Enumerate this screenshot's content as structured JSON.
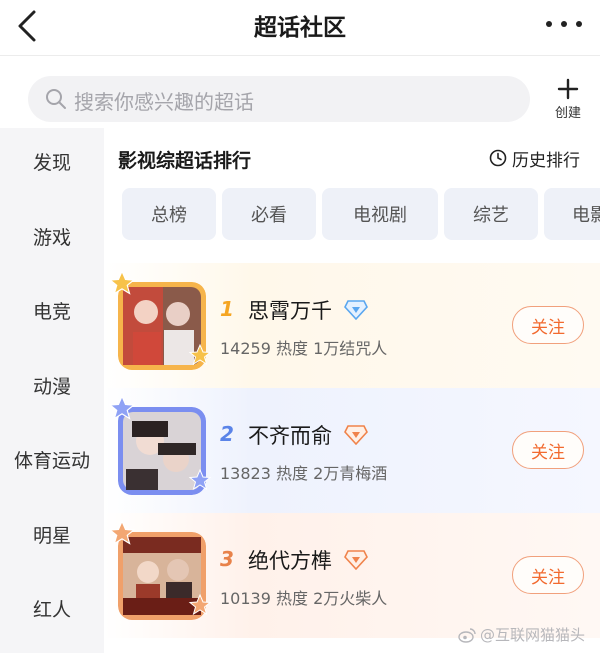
{
  "header": {
    "title": "超话社区",
    "back_icon": "chevron-left-icon",
    "more_icon": "more-horizontal-icon"
  },
  "search": {
    "placeholder": "搜索你感兴趣的超话",
    "create_label": "创建"
  },
  "sidebar": {
    "items": [
      {
        "label": "发现"
      },
      {
        "label": "游戏"
      },
      {
        "label": "电竞"
      },
      {
        "label": "动漫"
      },
      {
        "label": "体育运动"
      },
      {
        "label": "明星"
      },
      {
        "label": "红人"
      }
    ]
  },
  "main": {
    "section_title": "影视综超话排行",
    "history_label": "历史排行",
    "tabs": [
      {
        "label": "总榜"
      },
      {
        "label": "必看"
      },
      {
        "label": "电视剧"
      },
      {
        "label": "综艺"
      },
      {
        "label": "电影"
      }
    ],
    "rankings": [
      {
        "rank": "1",
        "name": "思霄万千",
        "stats": "14259 热度 1万结咒人",
        "follow_label": "关注",
        "rank_color": "#f5a623",
        "badge_color": "#5aa7f0"
      },
      {
        "rank": "2",
        "name": "不齐而俞",
        "stats": "13823 热度 2万青梅酒",
        "follow_label": "关注",
        "rank_color": "#5b84e8",
        "badge_color": "#f0834b"
      },
      {
        "rank": "3",
        "name": "绝代方榫",
        "stats": "10139 热度 2万火柴人",
        "follow_label": "关注",
        "rank_color": "#e8824a",
        "badge_color": "#f0834b"
      }
    ]
  },
  "watermark": {
    "text": "@互联网猫猫头"
  },
  "colors": {
    "accent": "#f26a2f",
    "sidebar_bg": "#f5f5f7",
    "tab_bg": "#eef1f8"
  }
}
